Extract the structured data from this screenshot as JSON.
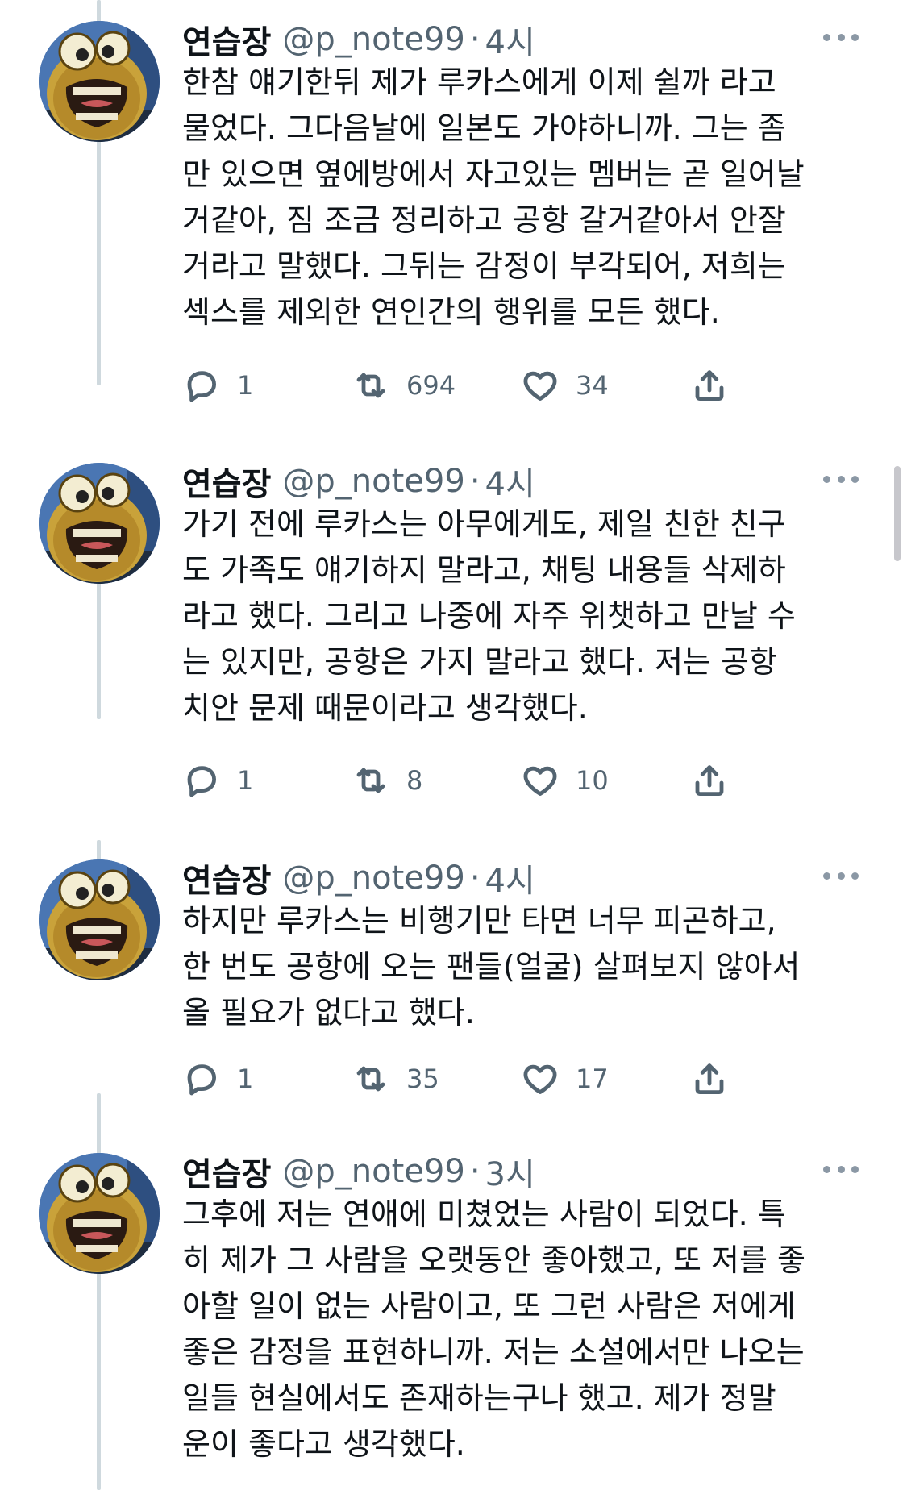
{
  "author": {
    "name": "연습장",
    "handle": "@p_note99",
    "dot": "·"
  },
  "icons": {
    "reply": "reply-icon",
    "retweet": "retweet-icon",
    "like": "like-icon",
    "share": "share-icon",
    "more": "more-icon"
  },
  "colors": {
    "text": "#0f1419",
    "secondary": "#536471",
    "thread_line": "#cfd9de"
  },
  "tweets": [
    {
      "time": "4시",
      "lines": [
        "한참 얘기한뒤 제가 루카스에게 이제 쉴까 라고",
        "물었다. 그다음날에 일본도 가야하니까. 그는 좀",
        "만 있으면 옆에방에서 자고있는 멤버는 곧 일어날",
        "거같아, 짐 조금 정리하고 공항 갈거같아서 안잘",
        "거라고 말했다. 그뒤는 감정이 부각되어, 저희는",
        "섹스를 제외한 연인간의 행위를 모든 했다."
      ],
      "replies": "1",
      "retweets": "694",
      "likes": "34"
    },
    {
      "time": "4시",
      "lines": [
        "가기 전에 루카스는 아무에게도, 제일 친한 친구",
        "도 가족도 얘기하지 말라고, 채팅 내용들 삭제하",
        "라고 했다. 그리고 나중에 자주 위챗하고 만날 수",
        "는 있지만, 공항은 가지 말라고 했다. 저는 공항",
        "치안 문제 때문이라고 생각했다."
      ],
      "replies": "1",
      "retweets": "8",
      "likes": "10"
    },
    {
      "time": "4시",
      "lines": [
        "하지만 루카스는 비행기만 타면 너무 피곤하고,",
        "한 번도 공항에 오는 팬들(얼굴) 살펴보지 않아서",
        "올 필요가 없다고 했다."
      ],
      "replies": "1",
      "retweets": "35",
      "likes": "17"
    },
    {
      "time": "3시",
      "lines": [
        "그후에 저는 연애에 미쳤었는 사람이 되었다. 특",
        "히 제가 그 사람을 오랫동안 좋아했고, 또 저를 좋",
        "아할 일이 없는 사람이고, 또 그런 사람은 저에게",
        "좋은 감정을 표현하니까. 저는 소설에서만 나오는",
        "일들 현실에서도 존재하는구나 했고. 제가 정말",
        "운이 좋다고 생각했다."
      ]
    }
  ]
}
